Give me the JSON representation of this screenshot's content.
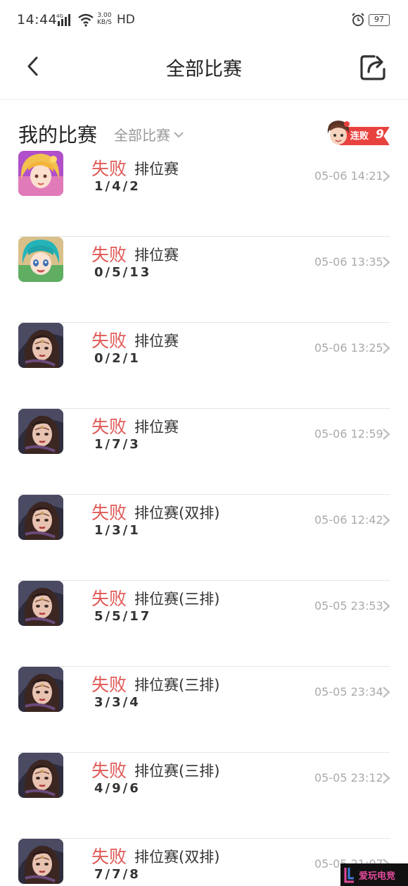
{
  "status_bar": {
    "time": "14:44",
    "network": "4G",
    "speed": "3.00\nKB/S",
    "speed_value": "3.00",
    "speed_unit": "KB/S",
    "hd": "HD",
    "battery": "97"
  },
  "nav": {
    "title": "全部比赛",
    "back_icon": "chevron-left-icon",
    "share_icon": "share-icon"
  },
  "section": {
    "title": "我的比赛",
    "filter_label": "全部比赛",
    "streak_label": "连败",
    "streak_count": "9"
  },
  "matches": [
    {
      "result": "失败",
      "mode": "排位赛",
      "kda": "1/4/2",
      "time": "05-06 14:21",
      "avatar": "blonde"
    },
    {
      "result": "失败",
      "mode": "排位赛",
      "kda": "0/5/13",
      "time": "05-06 13:35",
      "avatar": "teal"
    },
    {
      "result": "失败",
      "mode": "排位赛",
      "kda": "0/2/1",
      "time": "05-06 13:25",
      "avatar": "dark"
    },
    {
      "result": "失败",
      "mode": "排位赛",
      "kda": "1/7/3",
      "time": "05-06 12:59",
      "avatar": "dark"
    },
    {
      "result": "失败",
      "mode": "排位赛(双排)",
      "kda": "1/3/1",
      "time": "05-06 12:42",
      "avatar": "dark"
    },
    {
      "result": "失败",
      "mode": "排位赛(三排)",
      "kda": "5/5/17",
      "time": "05-05 23:53",
      "avatar": "dark"
    },
    {
      "result": "失败",
      "mode": "排位赛(三排)",
      "kda": "3/3/4",
      "time": "05-05 23:34",
      "avatar": "dark"
    },
    {
      "result": "失败",
      "mode": "排位赛(三排)",
      "kda": "4/9/6",
      "time": "05-05 23:12",
      "avatar": "dark"
    },
    {
      "result": "失败",
      "mode": "排位赛(双排)",
      "kda": "7/7/8",
      "time": "05-05 21:07",
      "avatar": "dark"
    }
  ],
  "watermark": {
    "text": "爱玩电竞"
  },
  "colors": {
    "loss": "#e05a57",
    "accent": "#e8423f",
    "muted": "#aaaaaa"
  }
}
